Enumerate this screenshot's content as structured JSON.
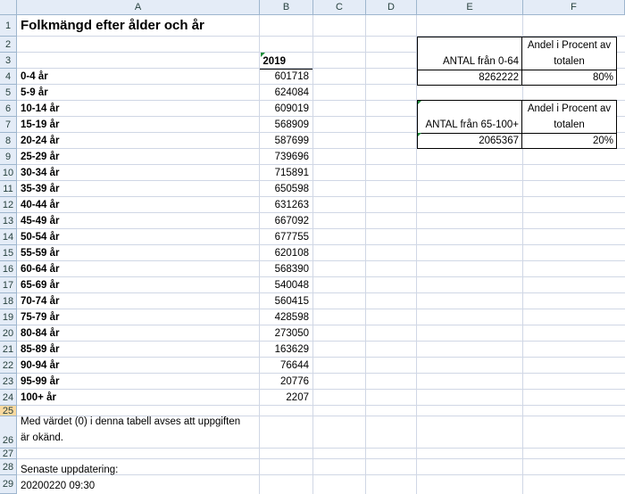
{
  "columns": [
    "A",
    "B",
    "C",
    "D",
    "E",
    "F"
  ],
  "rows": [
    "1",
    "2",
    "3",
    "4",
    "5",
    "6",
    "7",
    "8",
    "9",
    "10",
    "11",
    "12",
    "13",
    "14",
    "15",
    "16",
    "17",
    "18",
    "19",
    "20",
    "21",
    "22",
    "23",
    "24",
    "25",
    "26",
    "27",
    "28",
    "29"
  ],
  "title": "Folkmängd efter ålder och år",
  "year_header": "2019",
  "data": [
    {
      "label": "0-4 år",
      "value": "601718"
    },
    {
      "label": "5-9 år",
      "value": "624084"
    },
    {
      "label": "10-14 år",
      "value": "609019"
    },
    {
      "label": "15-19 år",
      "value": "568909"
    },
    {
      "label": "20-24 år",
      "value": "587699"
    },
    {
      "label": "25-29 år",
      "value": "739696"
    },
    {
      "label": "30-34 år",
      "value": "715891"
    },
    {
      "label": "35-39 år",
      "value": "650598"
    },
    {
      "label": "40-44 år",
      "value": "631263"
    },
    {
      "label": "45-49 år",
      "value": "667092"
    },
    {
      "label": "50-54 år",
      "value": "677755"
    },
    {
      "label": "55-59 år",
      "value": "620108"
    },
    {
      "label": "60-64 år",
      "value": "568390"
    },
    {
      "label": "65-69 år",
      "value": "540048"
    },
    {
      "label": "70-74 år",
      "value": "560415"
    },
    {
      "label": "75-79 år",
      "value": "428598"
    },
    {
      "label": "80-84 år",
      "value": "273050"
    },
    {
      "label": "85-89 år",
      "value": "163629"
    },
    {
      "label": "90-94 år",
      "value": "76644"
    },
    {
      "label": "95-99 år",
      "value": "20776"
    },
    {
      "label": "100+ år",
      "value": "2207"
    }
  ],
  "note_line1": "Med värdet (0) i denna tabell avses att uppgiften",
  "note_line2": "är okänd.",
  "updated_label": "Senaste uppdatering:",
  "updated_value": "20200220 09:30",
  "box1": {
    "header_left": "ANTAL från 0-64",
    "header_right_1": "Andel i Procent av",
    "header_right_2": "totalen",
    "value_left": "8262222",
    "value_right": "80%"
  },
  "box2": {
    "header_left": "ANTAL från 65-100+",
    "header_right_1": "Andel i Procent av",
    "header_right_2": "totalen",
    "value_left": "2065367",
    "value_right": "20%"
  },
  "colors": {
    "header_bg": "#e4ecf7",
    "gridline": "#d0d7e5",
    "selected_row": "#f9d99f",
    "error_marker": "#1f8c3a"
  }
}
